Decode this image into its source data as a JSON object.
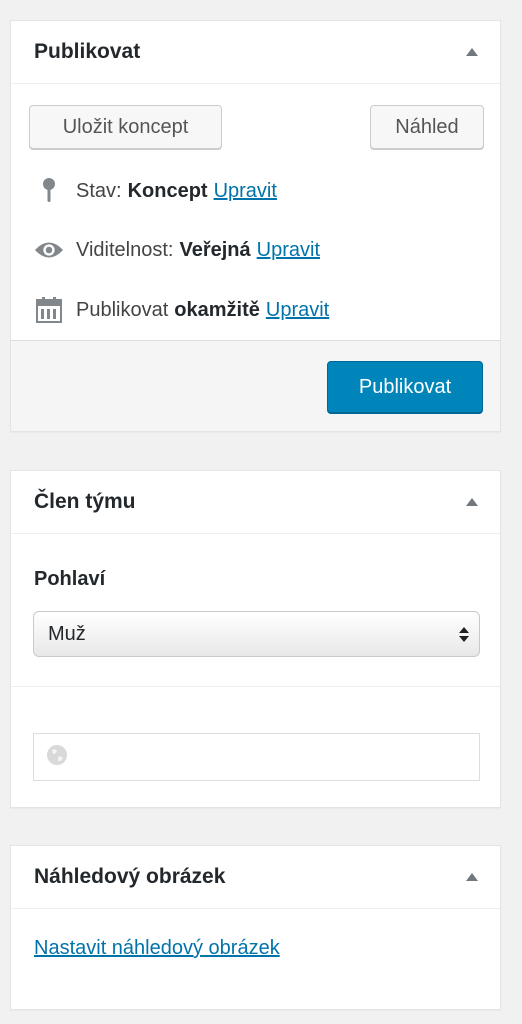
{
  "publish": {
    "title": "Publikovat",
    "save_draft_label": "Uložit koncept",
    "preview_label": "Náhled",
    "status_label": "Stav:",
    "status_value": "Koncept",
    "visibility_label": "Viditelnost:",
    "visibility_value": "Veřejná",
    "schedule_label": "Publikovat",
    "schedule_value": "okamžitě",
    "edit_link": "Upravit",
    "publish_button": "Publikovat"
  },
  "team_member": {
    "title": "Člen týmu",
    "gender_label": "Pohlaví",
    "gender_selected": "Muž",
    "url_value": ""
  },
  "featured_image": {
    "title": "Náhledový obrázek",
    "set_link": "Nastavit náhledový obrázek"
  },
  "icons": {
    "status": "pin-icon",
    "visibility": "eye-icon",
    "schedule": "calendar-icon",
    "url": "globe-icon",
    "toggle": "caret-up-icon"
  },
  "colors": {
    "accent": "#0085ba",
    "link": "#0073aa",
    "background": "#f1f1f1"
  }
}
